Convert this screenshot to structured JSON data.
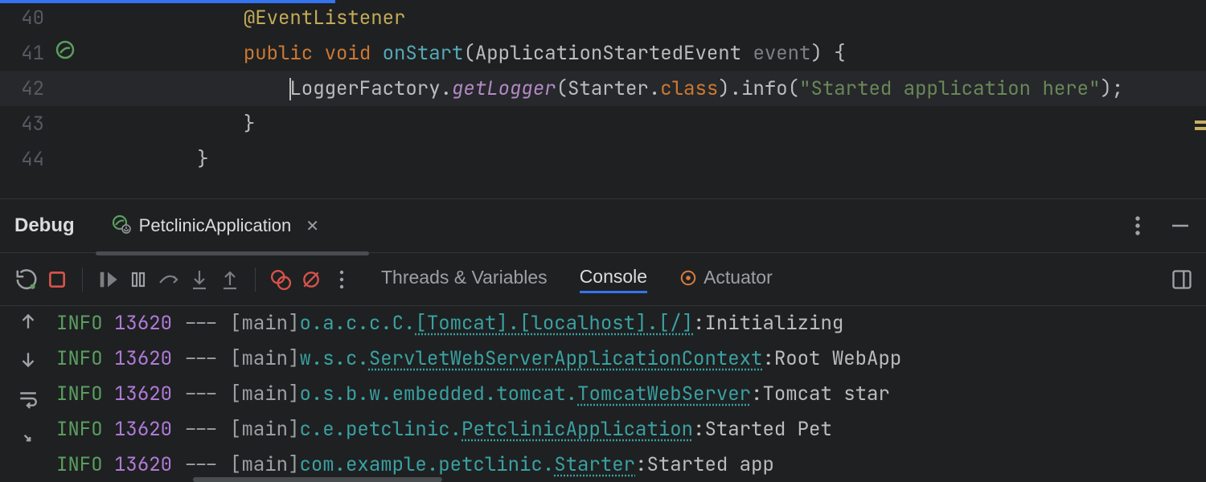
{
  "editor": {
    "lines": {
      "l40": {
        "num": "40",
        "tokens": {
          "indent": "            ",
          "anno": "@EventListener"
        }
      },
      "l41": {
        "num": "41",
        "tokens": {
          "indent": "            ",
          "kw1": "public ",
          "ret": "void ",
          "method": "onStart",
          "p1": "(",
          "type": "ApplicationStartedEvent ",
          "param": "event",
          "p2": ") {"
        }
      },
      "l42": {
        "num": "42",
        "tokens": {
          "indent": "                ",
          "t1": "LoggerFactory",
          "p1": ".",
          "t2": "getLogger",
          "p2": "(",
          "t3": "Starter",
          "p3": ".",
          "t4": "class",
          "p4": ").",
          "t5": "info",
          "p5": "(",
          "str": "\"Started application here\"",
          "p6": ");"
        }
      },
      "l43": {
        "num": "43",
        "tokens": {
          "indent": "            ",
          "brace": "}"
        }
      },
      "l44": {
        "num": "44",
        "tokens": {
          "indent": "        ",
          "brace": "}"
        }
      }
    }
  },
  "panel": {
    "label": "Debug",
    "run_config": "PetclinicApplication",
    "tabs": {
      "threads": "Threads & Variables",
      "console": "Console",
      "actuator": "Actuator"
    }
  },
  "console": {
    "lines": [
      {
        "level": "INFO",
        "pid": "13620",
        "dash": "---",
        "thread_open": "[",
        "thread_pad": "            ",
        "thread": "main] ",
        "logger_plain": "o.a.c.c.C.",
        "logger_dotted": "[Tomcat].[localhost].[/]",
        "colon_pad": "       : ",
        "msg": "Initializing"
      },
      {
        "level": "INFO",
        "pid": "13620",
        "dash": "---",
        "thread_open": "[",
        "thread_pad": "            ",
        "thread": "main] ",
        "logger_plain": "w.s.c.",
        "logger_dotted": "ServletWebServerApplicationContext",
        "colon_pad": " : ",
        "msg": "Root WebApp"
      },
      {
        "level": "INFO",
        "pid": "13620",
        "dash": "---",
        "thread_open": "[",
        "thread_pad": "            ",
        "thread": "main] ",
        "logger_plain": "o.s.b.w.embedded.tomcat.",
        "logger_dotted": "TomcatWebServer",
        "colon_pad": "  : ",
        "msg": "Tomcat star"
      },
      {
        "level": "INFO",
        "pid": "13620",
        "dash": "---",
        "thread_open": "[",
        "thread_pad": "            ",
        "thread": "main] ",
        "logger_plain": "c.e.petclinic.",
        "logger_dotted": "PetclinicApplication",
        "colon_pad": "       : ",
        "msg": "Started Pet"
      },
      {
        "level": "INFO",
        "pid": "13620",
        "dash": "---",
        "thread_open": "[",
        "thread_pad": "            ",
        "thread": "main] ",
        "logger_plain": "com.example.petclinic.",
        "logger_dotted": "Starter",
        "colon_pad": "            : ",
        "msg": "Started app"
      }
    ]
  }
}
